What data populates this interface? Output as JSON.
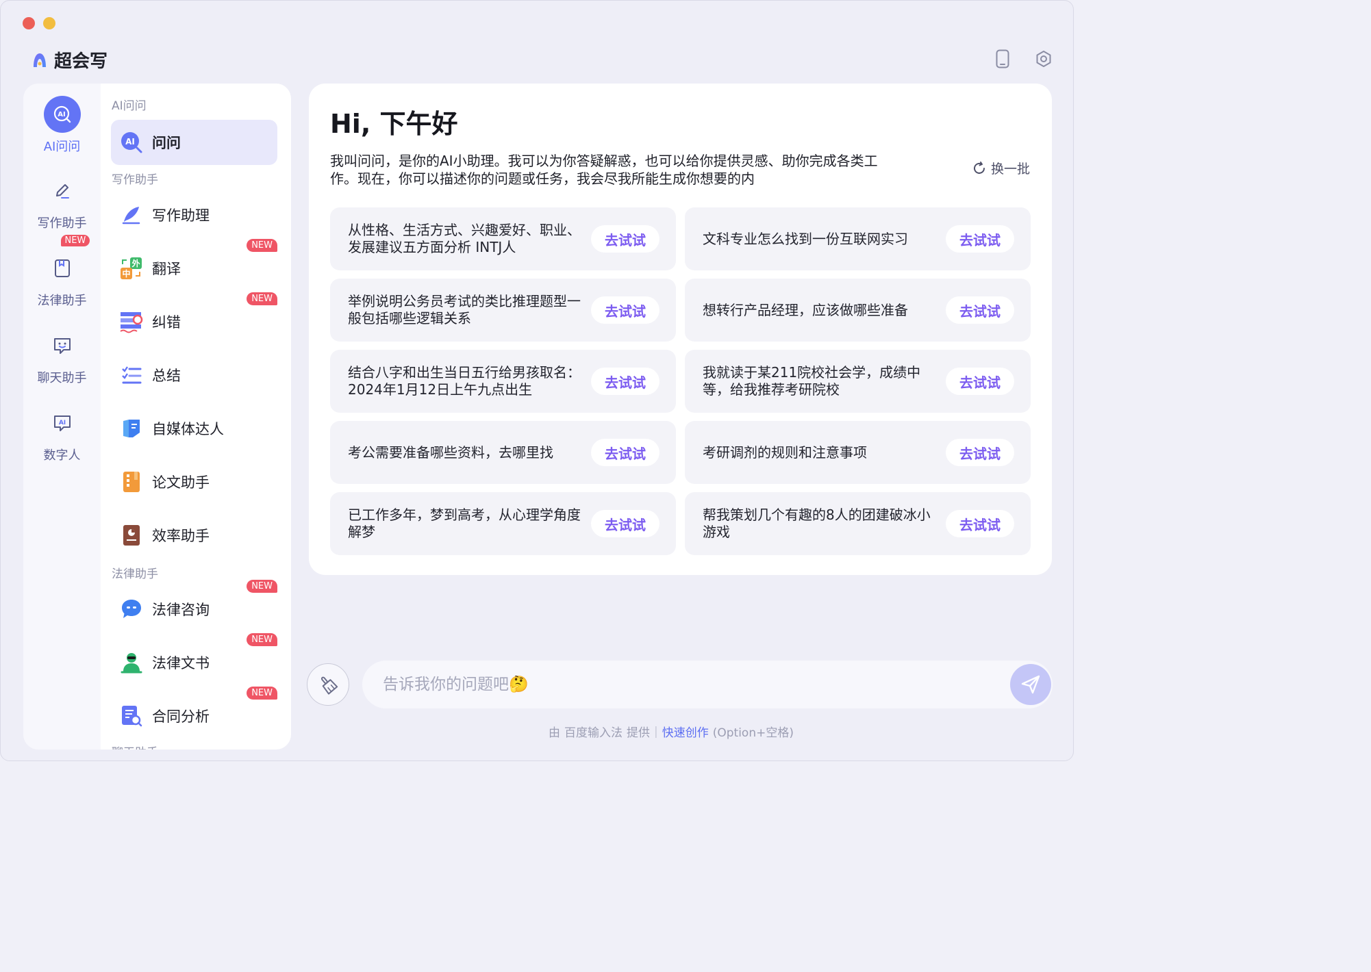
{
  "app": {
    "name": "超会写"
  },
  "rail": [
    {
      "label": "AI问问",
      "icon": "ai-chat-icon"
    },
    {
      "label": "写作助手",
      "icon": "pen-icon"
    },
    {
      "label": "法律助手",
      "icon": "book-icon",
      "badge": "NEW"
    },
    {
      "label": "聊天助手",
      "icon": "chat-face-icon"
    },
    {
      "label": "数字人",
      "icon": "ai-bubble-icon"
    }
  ],
  "sidebar": {
    "sections": [
      {
        "title": "AI问问"
      },
      {
        "title": "写作助手"
      },
      {
        "title": "法律助手"
      },
      {
        "title": "聊天助手"
      }
    ],
    "items": [
      {
        "label": "问问",
        "active": true
      },
      {
        "label": "写作助理"
      },
      {
        "label": "翻译",
        "badge": "NEW"
      },
      {
        "label": "纠错",
        "badge": "NEW"
      },
      {
        "label": "总结"
      },
      {
        "label": "自媒体达人"
      },
      {
        "label": "论文助手"
      },
      {
        "label": "效率助手"
      },
      {
        "label": "法律咨询",
        "badge": "NEW"
      },
      {
        "label": "法律文书",
        "badge": "NEW"
      },
      {
        "label": "合同分析",
        "badge": "NEW"
      }
    ],
    "translate_icon_text": {
      "top": "外",
      "bottom": "中"
    }
  },
  "main": {
    "greeting": "Hi, 下午好",
    "intro": "我叫问问，是你的AI小助理。我可以为你答疑解惑，也可以给你提供灵感、助你完成各类工作。现在，你可以描述你的问题或任务，我会尽我所能生成你想要的内",
    "refresh_label": "换一批",
    "try_label": "去试试",
    "cards": [
      "从性格、生活方式、兴趣爱好、职业、发展建议五方面分析 INTJ人",
      "文科专业怎么找到一份互联网实习",
      "举例说明公务员考试的类比推理题型一般包括哪些逻辑关系",
      "想转行产品经理，应该做哪些准备",
      "结合八字和出生当日五行给男孩取名：2024年1月12日上午九点出生",
      "我就读于某211院校社会学，成绩中等，给我推荐考研院校",
      "考公需要准备哪些资料，去哪里找",
      "考研调剂的规则和注意事项",
      "已工作多年，梦到高考，从心理学角度解梦",
      "帮我策划几个有趣的8人的团建破冰小游戏"
    ]
  },
  "input": {
    "placeholder": "告诉我你的问题吧🤔",
    "value": ""
  },
  "footer": {
    "by": "由",
    "provider": "百度输入法",
    "provided": "提供",
    "link": "快速创作",
    "shortcut": "(Option+空格)"
  },
  "colors": {
    "accent": "#6374f5",
    "try_text": "#7c5cf0",
    "badge": "#ef5565"
  }
}
